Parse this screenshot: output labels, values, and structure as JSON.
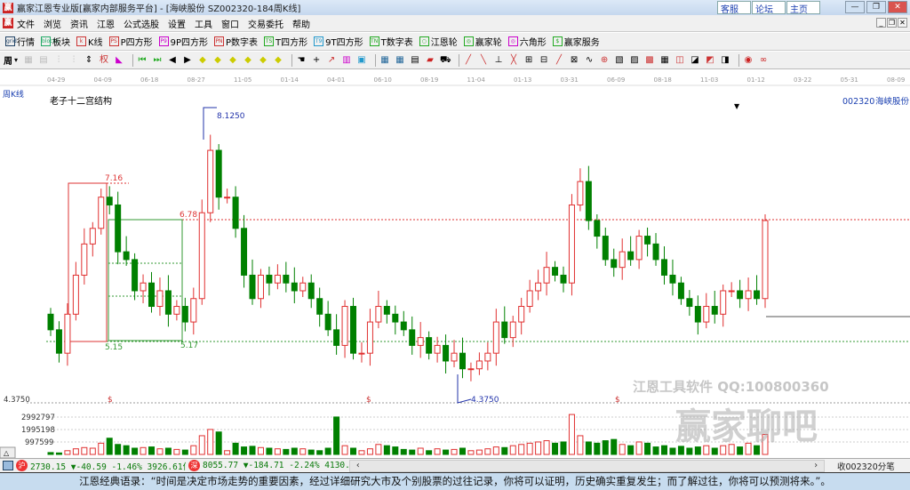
{
  "window": {
    "title": "赢家江恩专业版[赢家内部服务平台] - [海峡股份  SZ002320-184周K线]",
    "links": [
      "客服",
      "论坛",
      "主页"
    ]
  },
  "menu": [
    "文件",
    "浏览",
    "资讯",
    "江恩",
    "公式选股",
    "设置",
    "工具",
    "窗口",
    "交易委托",
    "帮助"
  ],
  "toolbar1": [
    "行情",
    "板块",
    "K线",
    "P四方形",
    "9P四方形",
    "P数字表",
    "T四方形",
    "9T四方形",
    "T数字表",
    "江恩轮",
    "赢家轮",
    "六角形",
    "赢家服务"
  ],
  "toolbar1_icons": [
    "grid",
    "blocks",
    "k",
    "PS",
    "P9",
    "PN",
    "TS",
    "T9",
    "TN",
    "○",
    "◎",
    "◎",
    "$"
  ],
  "period_select": "周",
  "chart": {
    "period_label": "周K线",
    "study_title": "老子十二宫结构",
    "stock_code": "002320",
    "stock_name": "海峡股份",
    "date_ticks": [
      "04-29",
      "04-09",
      "06-18",
      "08-27",
      "11-05",
      "01-14",
      "04-01",
      "06-10",
      "08-19",
      "11-04",
      "01-13",
      "03-31",
      "06-09",
      "08-18",
      "11-03",
      "01-12",
      "03-22",
      "05-31",
      "08-09"
    ],
    "annotations": {
      "high": "8.1250",
      "low": "4.3750",
      "level_a": "7.16",
      "level_b": "6.78",
      "level_c": "5.15",
      "level_d": "5.17"
    },
    "price_axis": {
      "label": "4.3750"
    },
    "volume_axis": [
      "2992797",
      "1995198",
      "997599"
    ],
    "dollar_marks": [
      "$",
      "$",
      "$"
    ]
  },
  "chart_data": {
    "type": "candlestick",
    "price_range": [
      4.375,
      8.125
    ],
    "closes": [
      5.3,
      5.0,
      5.5,
      6.0,
      6.4,
      6.6,
      7.0,
      6.9,
      6.3,
      6.2,
      5.8,
      5.9,
      5.6,
      5.8,
      5.5,
      5.6,
      5.4,
      5.7,
      6.8,
      7.6,
      7.0,
      7.0,
      6.6,
      6.0,
      5.7,
      6.0,
      5.9,
      6.0,
      5.9,
      5.8,
      5.9,
      5.7,
      5.5,
      5.3,
      5.1,
      5.6,
      5.0,
      5.0,
      5.4,
      5.6,
      5.5,
      5.4,
      5.3,
      5.1,
      5.2,
      5.0,
      5.1,
      4.9,
      5.0,
      4.8,
      4.8,
      4.9,
      5.0,
      5.4,
      5.2,
      5.4,
      5.6,
      5.8,
      5.9,
      6.1,
      6.0,
      5.9,
      6.9,
      7.2,
      6.7,
      6.5,
      6.2,
      6.1,
      6.3,
      6.2,
      6.5,
      6.4,
      6.2,
      6.0,
      5.9,
      5.7,
      5.6,
      5.4,
      5.6,
      5.5,
      5.8,
      5.8,
      5.7,
      5.8,
      5.7,
      6.7
    ],
    "volumes": [
      150000,
      120000,
      300000,
      450000,
      550000,
      500000,
      900000,
      1300000,
      800000,
      700000,
      500000,
      550000,
      600000,
      450000,
      500000,
      400000,
      350000,
      700000,
      1500000,
      2000000,
      1800000,
      300000,
      900000,
      600000,
      650000,
      550000,
      500000,
      450000,
      400000,
      500000,
      450000,
      350000,
      300000,
      500000,
      3000000,
      700000,
      500000,
      300000,
      450000,
      800000,
      700000,
      600000,
      400000,
      350000,
      500000,
      300000,
      450000,
      350000,
      400000,
      500000,
      300000,
      350000,
      450000,
      600000,
      550000,
      700000,
      800000,
      900000,
      1000000,
      1100000,
      900000,
      1000000,
      3200000,
      1500000,
      1000000,
      900000,
      1100000,
      1200000,
      800000,
      700000,
      1000000,
      900000,
      600000,
      700000,
      500000,
      650000,
      500000,
      600000,
      700000,
      500000,
      700000,
      800000,
      600000,
      900000,
      700000,
      1600000
    ]
  },
  "statusbar": {
    "sh_icon": "沪",
    "sh": "2730.15 ▼-40.59 -1.46% 3926.61亿",
    "sz_icon": "深",
    "sz": "8055.77 ▼-184.71 -2.24% 4130.26",
    "right": "收002320分笔"
  },
  "watermark": {
    "line1": "江恩工具软件  QQ:100800360",
    "line2": "赢家聊吧"
  },
  "quote": "江恩经典语录：“时间是决定市场走势的重要因素，经过详细研究大市及个别股票的过往记录，你将可以证明，历史确实重复发生；而了解过往，你将可以预测将来。”。"
}
